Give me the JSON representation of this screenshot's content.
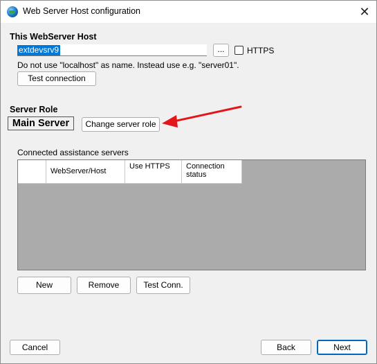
{
  "window": {
    "title": "Web Server Host configuration",
    "close_glyph": "✕"
  },
  "host_section": {
    "heading": "This WebServer Host",
    "host_value": "extdevsrv9",
    "browse_label": "...",
    "https_label": "HTTPS",
    "https_checked": false,
    "hint": "Do not use \"localhost\" as name. Instead use e.g. \"server01\".",
    "test_connection_label": "Test connection"
  },
  "role_section": {
    "heading": "Server Role",
    "role_value": "Main Server",
    "change_role_label": "Change server role"
  },
  "assist_section": {
    "label": "Connected assistance servers",
    "columns": [
      "",
      "WebServer/Host",
      "Use HTTPS",
      "Connection status"
    ],
    "rows": [],
    "new_label": "New",
    "remove_label": "Remove",
    "test_conn_label": "Test Conn."
  },
  "footer": {
    "cancel_label": "Cancel",
    "back_label": "Back",
    "next_label": "Next"
  },
  "annotation": {
    "arrow_color": "#e3161b"
  }
}
